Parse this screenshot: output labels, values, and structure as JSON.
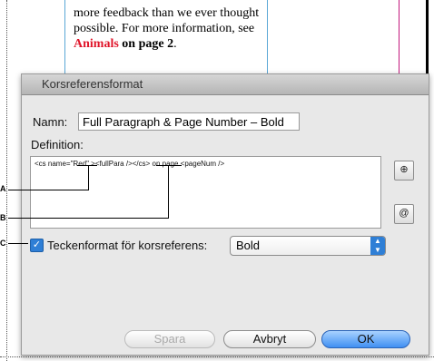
{
  "document": {
    "line1": "more feedback than we ever thought",
    "line2": "possible. For more information, see",
    "link_red": "Animals",
    "link_bold": "on page 2",
    "period": "."
  },
  "dialog": {
    "title": "Korsreferensformat",
    "name_label": "Namn:",
    "name_value": "Full Paragraph & Page Number – Bold",
    "definition_label": "Definition:",
    "definition_text": "<cs name=\"Red\" ><fullPara /></cs> on page <pageNum />",
    "char_format_label": "Teckenformat för korsreferens:",
    "char_format_checked": true,
    "char_format_value": "Bold",
    "buttons": {
      "save": "Spara",
      "cancel": "Avbryt",
      "ok": "OK"
    },
    "side_buttons": [
      "insert-building-block-icon",
      "insert-special-character-icon"
    ]
  },
  "callouts": {
    "a": "A",
    "b": "B",
    "c": "C"
  }
}
